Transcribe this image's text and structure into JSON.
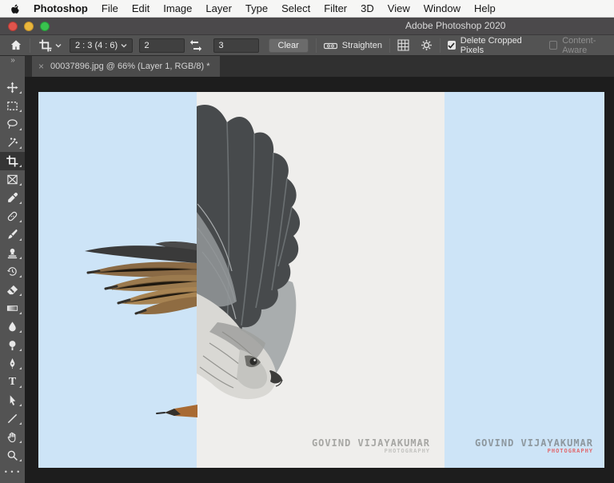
{
  "menu_bar": {
    "items": [
      "Photoshop",
      "File",
      "Edit",
      "Image",
      "Layer",
      "Type",
      "Select",
      "Filter",
      "3D",
      "View",
      "Window",
      "Help"
    ]
  },
  "title_bar": {
    "title": "Adobe Photoshop 2020"
  },
  "options_bar": {
    "ratio_label": "2 : 3 (4 : 6)",
    "width_value": "2",
    "height_value": "3",
    "clear_label": "Clear",
    "straighten_label": "Straighten",
    "delete_cropped_label": "Delete Cropped Pixels",
    "content_aware_label": "Content-Aware"
  },
  "document_tab": {
    "close_glyph": "×",
    "title": "00037896.jpg @ 66% (Layer 1, RGB/8) *"
  },
  "toolbar": {
    "collapse_glyph": "»",
    "more_glyph": "• • •",
    "type_tool_glyph": "T"
  },
  "canvas": {
    "watermark_left": {
      "line1": "GOVIND VIJAYAKUMAR",
      "line2": "PHOTOGRAPHY"
    },
    "watermark_right": {
      "line1": "GOVIND VIJAYAKUMAR",
      "line2": "PHOTOGRAPHY"
    },
    "colors": {
      "sky_blue": "#cde4f7",
      "strip_white": "#efeeec",
      "watermark_red": "#e0696e",
      "tail_brown": "#9b7a4e"
    }
  }
}
